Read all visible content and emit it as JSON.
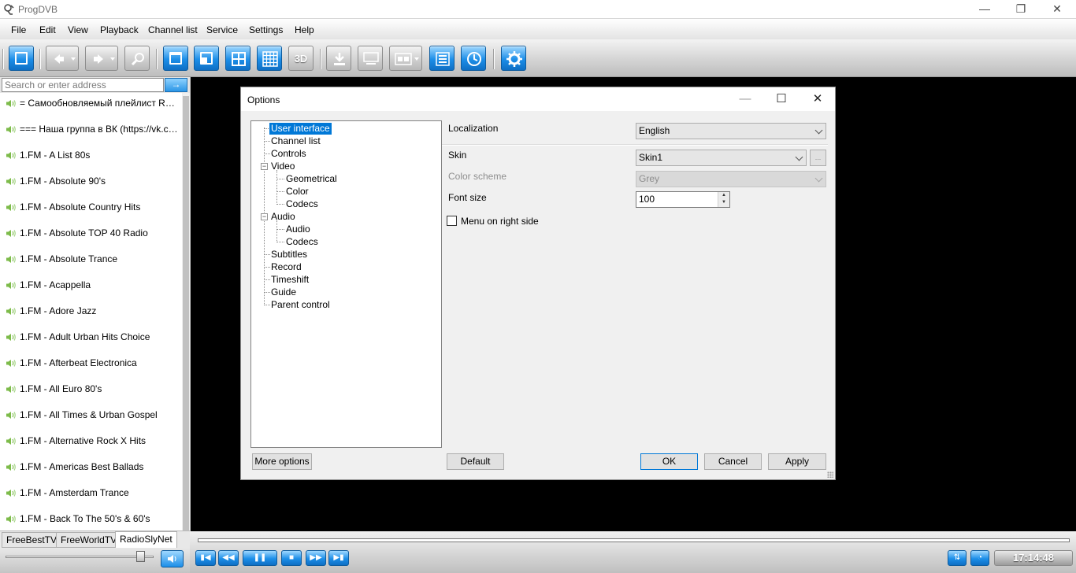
{
  "app": {
    "title": "ProgDVB"
  },
  "window_controls": {
    "minimize": "—",
    "restore": "❐",
    "close": "✕"
  },
  "menu": [
    "File",
    "Edit",
    "View",
    "Playback",
    "Channel list",
    "Service",
    "Settings",
    "Help"
  ],
  "toolbar": {
    "buttons": [
      "channel-list-icon",
      "back-icon",
      "forward-icon",
      "search-icon",
      "single-view-icon",
      "pip-icon",
      "four-view-icon",
      "grid-view-icon",
      "3d-icon",
      "record-icon",
      "teletext-icon",
      "subtitles-icon",
      "epg-list-icon",
      "timer-icon",
      "settings-gear-icon"
    ],
    "label_3d": "3D"
  },
  "search": {
    "placeholder": "Search or enter address",
    "go_label": "→"
  },
  "channels": [
    "= Самообновляемый плейлист Radio...",
    "=== Наша группа в ВК (https://vk.com...",
    "1.FM - A List 80s",
    "1.FM - Absolute 90's",
    "1.FM - Absolute Country Hits",
    "1.FM - Absolute TOP 40 Radio",
    "1.FM - Absolute Trance",
    "1.FM - Acappella",
    "1.FM - Adore Jazz",
    "1.FM - Adult Urban Hits Choice",
    "1.FM - Afterbeat Electronica",
    "1.FM - All Euro 80's",
    "1.FM - All Times & Urban Gospel",
    "1.FM - Alternative Rock X Hits",
    "1.FM - Americas Best Ballads",
    "1.FM - Amsterdam Trance",
    "1.FM - Back To The 50's & 60's"
  ],
  "tabs": [
    "FreeBestTV",
    "FreeWorldTV",
    "RadioSlyNet"
  ],
  "active_tab": "RadioSlyNet",
  "volume_level": 0.92,
  "playback": {
    "clock": "17:14:48",
    "buttons": [
      "prev-icon",
      "rewind-icon",
      "pause-icon",
      "stop-icon",
      "fast-forward-icon",
      "next-icon"
    ]
  },
  "dialog": {
    "title": "Options",
    "controls": {
      "minimize": "—",
      "maximize": "☐",
      "close": "✕"
    },
    "tree": {
      "user_interface": "User interface",
      "channel_list": "Channel list",
      "controls": "Controls",
      "video": "Video",
      "geometrical": "Geometrical",
      "color": "Color",
      "video_codecs": "Codecs",
      "audio": "Audio",
      "audio_sub": "Audio",
      "audio_codecs": "Codecs",
      "subtitles": "Subtitles",
      "record": "Record",
      "timeshift": "Timeshift",
      "guide": "Guide",
      "parent_control": "Parent control",
      "selected": "User interface"
    },
    "props": {
      "localization_label": "Localization",
      "localization_value": "English",
      "skin_label": "Skin",
      "skin_value": "Skin1",
      "skin_more": "...",
      "color_scheme_label": "Color scheme",
      "color_scheme_value": "Grey",
      "font_size_label": "Font size",
      "font_size_value": "100",
      "menu_right_label": "Menu on right side",
      "menu_right_checked": false
    },
    "buttons": {
      "more_options": "More options",
      "default": "Default",
      "ok": "OK",
      "cancel": "Cancel",
      "apply": "Apply"
    }
  },
  "colors": {
    "selection": "#0078d7",
    "accent_blue": "#1c8ee8",
    "video_bg": "#000000"
  }
}
